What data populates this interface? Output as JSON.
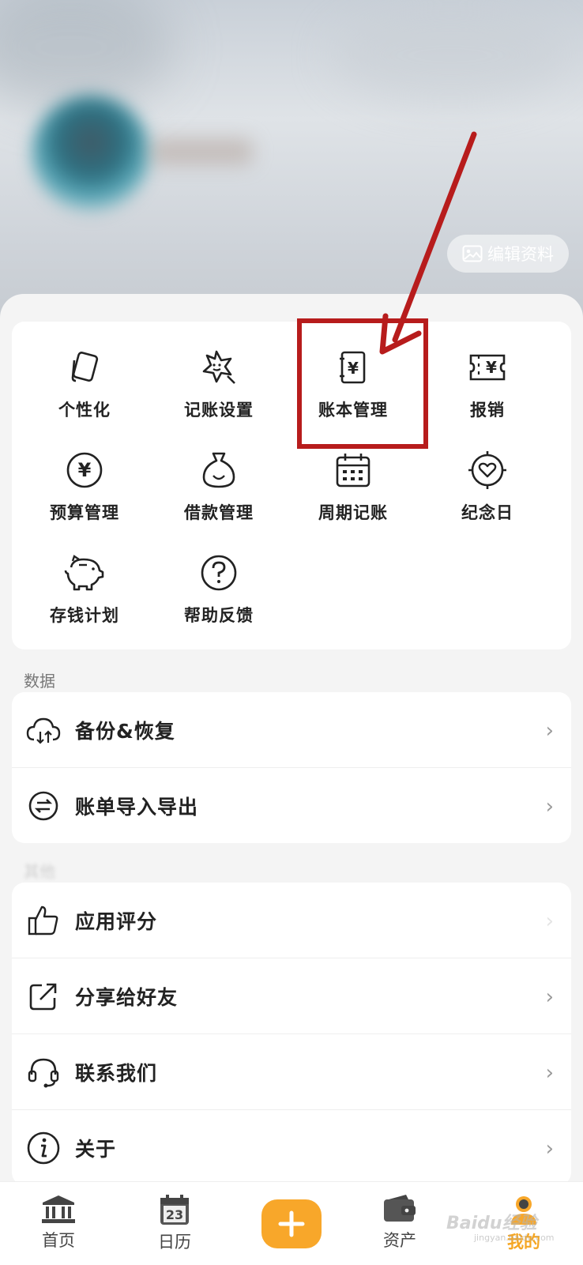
{
  "header": {
    "edit_profile_label": "编辑资料"
  },
  "grid": {
    "items": [
      {
        "label": "个性化",
        "icon": "personalize-icon"
      },
      {
        "label": "记账设置",
        "icon": "bookkeeping-settings-icon"
      },
      {
        "label": "账本管理",
        "icon": "ledger-management-icon"
      },
      {
        "label": "报销",
        "icon": "reimbursement-icon"
      },
      {
        "label": "预算管理",
        "icon": "budget-management-icon"
      },
      {
        "label": "借款管理",
        "icon": "loan-management-icon"
      },
      {
        "label": "周期记账",
        "icon": "recurring-bookkeeping-icon"
      },
      {
        "label": "纪念日",
        "icon": "anniversary-icon"
      },
      {
        "label": "存钱计划",
        "icon": "savings-plan-icon"
      },
      {
        "label": "帮助反馈",
        "icon": "help-feedback-icon"
      }
    ]
  },
  "data_section": {
    "title": "数据",
    "rows": [
      {
        "label": "备份&恢复",
        "icon": "cloud-backup-icon"
      },
      {
        "label": "账单导入导出",
        "icon": "import-export-icon"
      }
    ]
  },
  "other_section": {
    "title": "其他",
    "rows": [
      {
        "label": "应用评分",
        "icon": "thumbs-up-icon"
      },
      {
        "label": "分享给好友",
        "icon": "share-icon"
      },
      {
        "label": "联系我们",
        "icon": "headset-icon"
      },
      {
        "label": "关于",
        "icon": "info-icon"
      }
    ]
  },
  "tabbar": {
    "tabs": [
      {
        "label": "首页",
        "icon": "bank-icon"
      },
      {
        "label": "日历",
        "icon": "calendar-icon",
        "calendar_day": "23"
      },
      {
        "label": "资产",
        "icon": "wallet-icon"
      },
      {
        "label": "我的",
        "icon": "profile-icon",
        "active": true
      }
    ],
    "add_button_icon": "plus-icon"
  },
  "watermark": {
    "text": "Baidu经验",
    "sub": "jingyan.baidu.com"
  },
  "colors": {
    "accent": "#f8a72a",
    "highlight": "#b71c1c"
  }
}
